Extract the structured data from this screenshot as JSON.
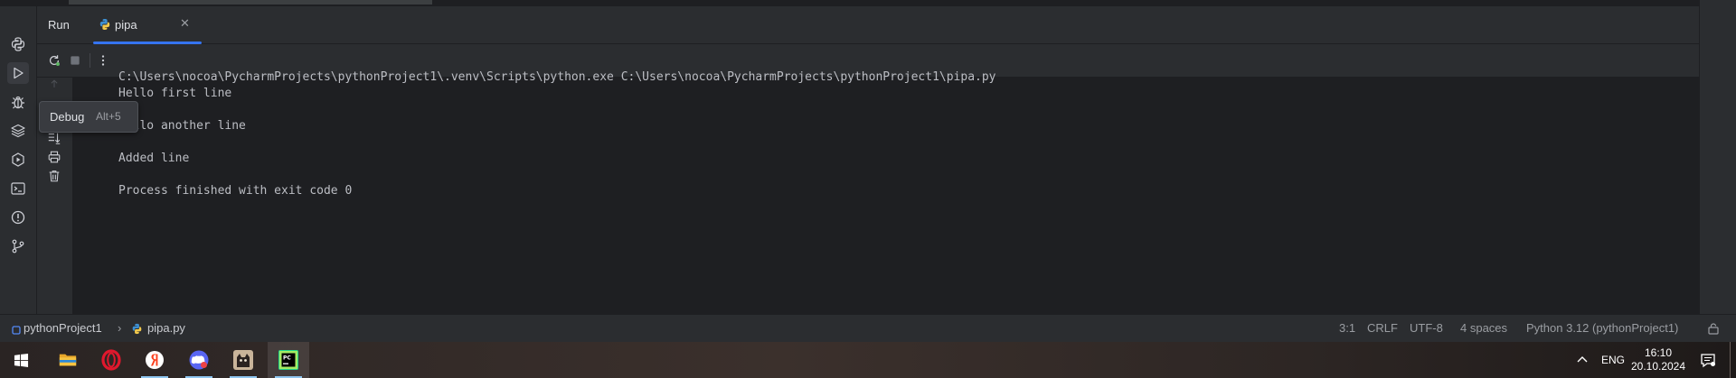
{
  "run_panel": {
    "run_label": "Run",
    "tab_label": "pipa"
  },
  "tooltip": {
    "label": "Debug",
    "shortcut": "Alt+5"
  },
  "console": {
    "lines": [
      "C:\\Users\\nocoa\\PycharmProjects\\pythonProject1\\.venv\\Scripts\\python.exe C:\\Users\\nocoa\\PycharmProjects\\pythonProject1\\pipa.py",
      "Hello first line",
      "",
      "Hello another line",
      "",
      "Added line",
      "",
      "Process finished with exit code 0"
    ]
  },
  "status_bar": {
    "project": "pythonProject1",
    "file": "pipa.py",
    "position": "3:1",
    "line_ending": "CRLF",
    "encoding": "UTF-8",
    "indent": "4 spaces",
    "interpreter": "Python 3.12 (pythonProject1)"
  },
  "taskbar": {
    "language": "ENG",
    "time": "16:10",
    "date": "20.10.2024",
    "apps": [
      "windows-start",
      "file-explorer",
      "opera",
      "yandex-browser",
      "discord",
      "cat-app",
      "pycharm"
    ]
  },
  "colors": {
    "accent": "#3574f0",
    "panel_bg": "#2b2d30",
    "console_bg": "#1e1f22",
    "text": "#bcbec4"
  }
}
